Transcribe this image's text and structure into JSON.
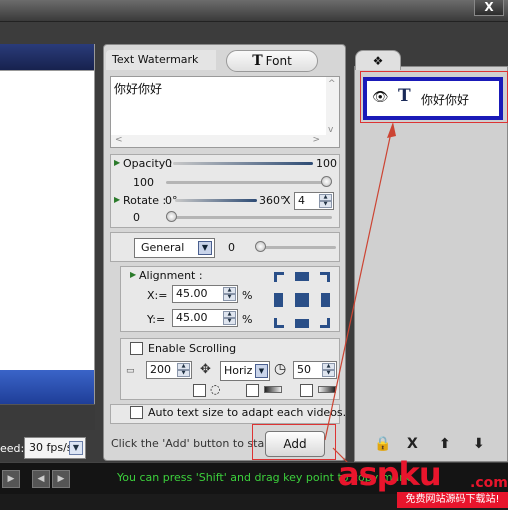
{
  "window": {
    "close_label": "X"
  },
  "speed": {
    "label": "eed:",
    "value": "30 fps/s"
  },
  "center": {
    "tabs": {
      "watermark": "Text Watermark",
      "font_icon": "T",
      "font": "Font"
    },
    "text_value": "你好你好",
    "opacity": {
      "label": "Opacity :",
      "min": "0",
      "max": "100",
      "value": "100",
      "fraction": 1.0
    },
    "rotate": {
      "label": "Rotate  :",
      "min": "0°",
      "max": "360°",
      "value": "0",
      "times_symbol": "X",
      "multiplier": "4",
      "fraction": 0.0
    },
    "general": {
      "select": "General",
      "value": "0",
      "fraction": 0.0
    },
    "alignment": {
      "label": "Alignment :",
      "x_label": "X:=",
      "x_value": "45.00",
      "y_label": "Y:=",
      "y_value": "45.00",
      "unit": "%"
    },
    "scrolling": {
      "label": "Enable Scrolling",
      "value": "200",
      "direction": "Horiz",
      "speed_value": "50"
    },
    "auto_text": "Auto text size to adapt each videos.",
    "hint": "Click the 'Add' button to start ->",
    "add_button": "Add"
  },
  "layers": {
    "item_icon": "T",
    "item_label": "你好你好",
    "tools": {
      "lock": "🔒",
      "delete": "X",
      "up": "⬆",
      "down": "⬇"
    }
  },
  "status": {
    "text": "You can press 'Shift' and drag key point to copy mark."
  },
  "logo": {
    "main": "aspku",
    "domain": ".com",
    "sub": "免费网站源码下载站!"
  },
  "colors": {
    "layer_border": "#1a1ab8",
    "highlight": "#dd3333",
    "status_text": "#3cd03c",
    "logo": "#e8152c"
  }
}
